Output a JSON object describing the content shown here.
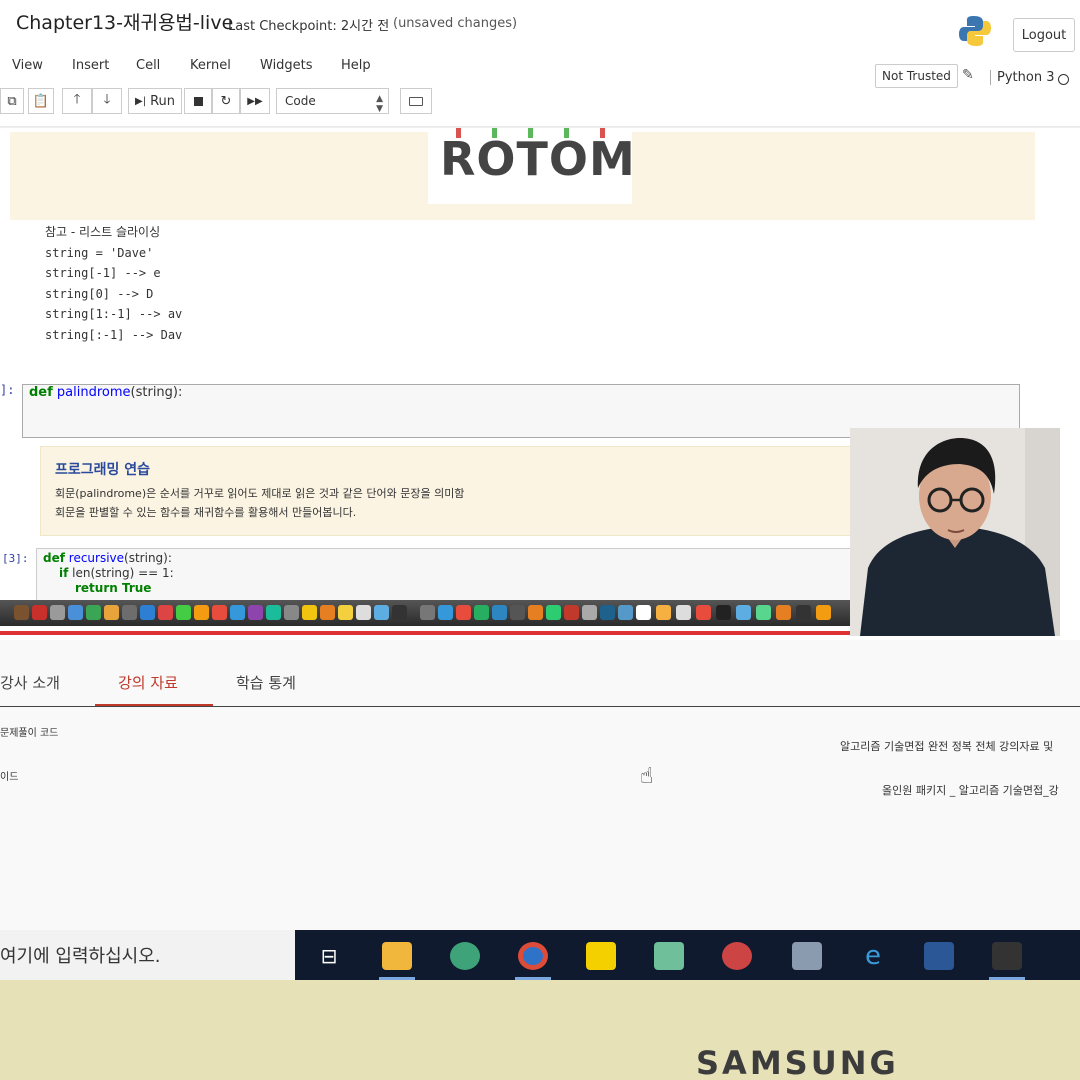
{
  "notebook": {
    "title": "Chapter13-재귀용법-live",
    "checkpoint": "Last Checkpoint: 2시간 전",
    "unsaved": "(unsaved changes)",
    "logout_label": "Logout",
    "not_trusted_label": "Not Trusted",
    "kernel_name": "Python 3"
  },
  "menu": [
    "View",
    "Insert",
    "Cell",
    "Kernel",
    "Widgets",
    "Help"
  ],
  "toolbar": {
    "run_label": "Run",
    "cell_type": "Code"
  },
  "cells": {
    "logo_text": "ROTOM",
    "slicing": {
      "title": "참고 - 리스트 슬라이싱",
      "lines": [
        "string = 'Dave'",
        "string[-1] --> e",
        "string[0] --> D",
        "string[1:-1] --> av",
        "string[:-1] --> Dav"
      ]
    },
    "palindrome": {
      "prompt": "]:",
      "kw": "def",
      "name": "palindrome",
      "args": "(string):"
    },
    "practice": {
      "title": "프로그래밍 연습",
      "line1": "회문(palindrome)은 순서를 거꾸로 읽어도 제대로 읽은 것과 같은 단어와 문장을 의미함",
      "line2": "회문을 판별할 수 있는 함수를 재귀함수를 활용해서 만들어봅니다."
    },
    "recursive": {
      "prompt": "[3]:",
      "line1_kw": "def",
      "line1_name": "recursive",
      "line1_args": "(string):",
      "line2_kw": "if",
      "line2_rest": "len(string) == 1:",
      "line3_kw": "return True"
    }
  },
  "course": {
    "tabs": [
      "강사 소개",
      "강의 자료",
      "학습 통계"
    ],
    "active_tab": "강의 자료",
    "left_items": [
      "문제풀이 코드",
      "이드"
    ],
    "right_items": [
      "알고리즘 기술면접 완전 정복 전체 강의자료 및",
      "올인원 패키지 _ 알고리즘 기술면접_강"
    ]
  },
  "taskbar": {
    "search_placeholder": "여기에 입력하십시오."
  },
  "bezel": {
    "brand": "SAMSUNG"
  },
  "colors": {
    "accent_red": "#c0392b",
    "markdown_bg": "#fbf4e3",
    "taskbar": "#0f1a2e",
    "bezel": "#e7e1b7"
  }
}
